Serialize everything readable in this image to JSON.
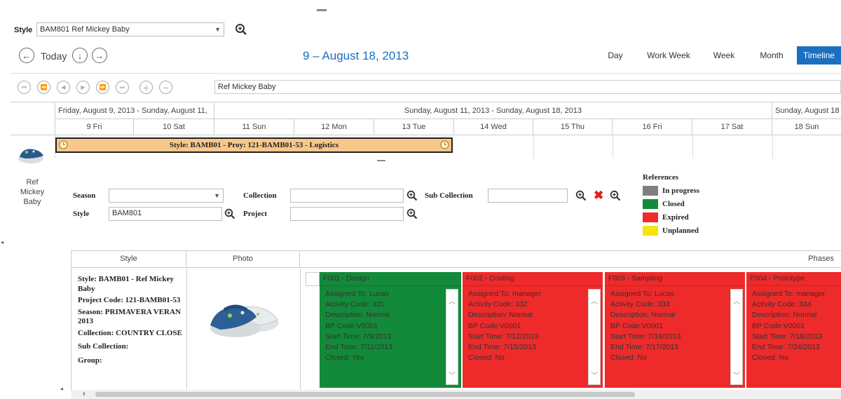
{
  "toolbar": {
    "style_label": "Style",
    "style_value": "BAM801 Ref Mickey Baby",
    "today_label": "Today",
    "date_range_title": "9 – August 18, 2013"
  },
  "views": [
    {
      "label": "Day"
    },
    {
      "label": "Work Week"
    },
    {
      "label": "Week"
    },
    {
      "label": "Month"
    },
    {
      "label": "Timeline"
    }
  ],
  "resource_select": {
    "value": "Ref Mickey Baby"
  },
  "timeline": {
    "range_headers": [
      "Friday, August 9, 2013 - Sunday, August 11,",
      "Sunday, August 11, 2013 - Sunday, August 18, 2013",
      "Sunday, August 18"
    ],
    "days": [
      "9 Fri",
      "10 Sat",
      "11 Sun",
      "12 Mon",
      "13 Tue",
      "14 Wed",
      "15 Thu",
      "16 Fri",
      "17 Sat",
      "18 Sun"
    ],
    "appointment": "Style: BAMB01 - Proy: 121-BAMB01-53 - Logistics",
    "resource_name": "Ref Mickey Baby"
  },
  "filters": {
    "season_label": "Season",
    "season_value": "",
    "collection_label": "Collection",
    "collection_value": "",
    "subcollection_label": "Sub Collection",
    "subcollection_value": "",
    "style_label": "Style",
    "style_value": "BAM801",
    "project_label": "Project",
    "project_value": ""
  },
  "legend": {
    "title": "References",
    "items": [
      {
        "label": "In progress",
        "color": "#808080"
      },
      {
        "label": "Closed",
        "color": "#138a3a"
      },
      {
        "label": "Expired",
        "color": "#ee2a2a"
      },
      {
        "label": "Unplanned",
        "color": "#f5e40f"
      }
    ]
  },
  "grid": {
    "headers": {
      "style": "Style",
      "photo": "Photo",
      "phases": "Phases"
    },
    "style_info": [
      "Style: BAMB01 - Ref Mickey Baby",
      "Project Code: 121-BAMB01-53",
      "Season: PRIMAVERA VERAN 2013",
      "Collection: COUNTRY CLOSE",
      "Sub Collection:",
      "Group:"
    ],
    "phases": [
      {
        "title": "F001 - Design",
        "color": "#138a3a",
        "lines": [
          "Assigned To: Lucas",
          "Activity Code: 331",
          "Description: Normal",
          "BP Code:V0001",
          "Start Time: 7/9/2013",
          "End Time: 7/11/2013",
          "Closed: Yes"
        ]
      },
      {
        "title": "F002 - Costing",
        "color": "#ee2a2a",
        "lines": [
          "Assigned To: manager",
          "Activity Code: 332",
          "Description: Normal",
          "BP Code:V0001",
          "Start Time: 7/12/2013",
          "End Time: 7/15/2013",
          "Closed: No"
        ]
      },
      {
        "title": "F003 - Sampling",
        "color": "#ee2a2a",
        "lines": [
          "Assigned To: Lucas",
          "Activity Code: 333",
          "Description: Normal",
          "BP Code:V0001",
          "Start Time: 7/16/2013",
          "End Time: 7/17/2013",
          "Closed: No"
        ]
      },
      {
        "title": "F004 - Prototype",
        "color": "#ee2a2a",
        "lines": [
          "Assigned To: manager",
          "Activity Code: 334",
          "Description: Normal",
          "BP Code:V0001",
          "Start Time: 7/18/2013",
          "End Time: 7/24/2013",
          "Closed: No"
        ]
      }
    ]
  },
  "icons": {
    "zoom": "zoom-icon",
    "back": "arrow-left-icon",
    "forward": "arrow-right-icon",
    "down": "arrow-down-icon",
    "delete": "delete-x-icon",
    "clock": "clock-icon"
  }
}
